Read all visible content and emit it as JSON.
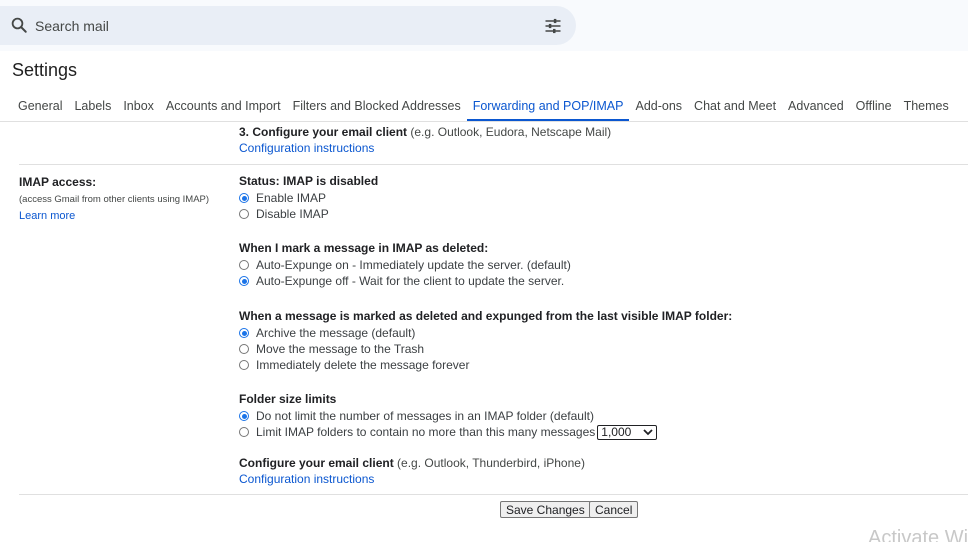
{
  "search": {
    "placeholder": "Search mail"
  },
  "page_title": "Settings",
  "tabs": [
    {
      "label": "General",
      "active": false
    },
    {
      "label": "Labels",
      "active": false
    },
    {
      "label": "Inbox",
      "active": false
    },
    {
      "label": "Accounts and Import",
      "active": false
    },
    {
      "label": "Filters and Blocked Addresses",
      "active": false
    },
    {
      "label": "Forwarding and POP/IMAP",
      "active": true
    },
    {
      "label": "Add-ons",
      "active": false
    },
    {
      "label": "Chat and Meet",
      "active": false
    },
    {
      "label": "Advanced",
      "active": false
    },
    {
      "label": "Offline",
      "active": false
    },
    {
      "label": "Themes",
      "active": false
    }
  ],
  "pop_config": {
    "heading": "3. Configure your email client",
    "hint": "(e.g. Outlook, Eudora, Netscape Mail)",
    "link": "Configuration instructions"
  },
  "imap": {
    "label": "IMAP access:",
    "sub": "(access Gmail from other clients using IMAP)",
    "learn_more": "Learn more",
    "status": "Status: IMAP is disabled",
    "access_options": [
      {
        "label": "Enable IMAP",
        "checked": true
      },
      {
        "label": "Disable IMAP",
        "checked": false
      }
    ],
    "deleted_heading": "When I mark a message in IMAP as deleted:",
    "deleted_options": [
      {
        "label": "Auto-Expunge on - Immediately update the server. (default)",
        "checked": false
      },
      {
        "label": "Auto-Expunge off - Wait for the client to update the server.",
        "checked": true
      }
    ],
    "expunged_heading": "When a message is marked as deleted and expunged from the last visible IMAP folder:",
    "expunged_options": [
      {
        "label": "Archive the message (default)",
        "checked": true
      },
      {
        "label": "Move the message to the Trash",
        "checked": false
      },
      {
        "label": "Immediately delete the message forever",
        "checked": false
      }
    ],
    "folder_heading": "Folder size limits",
    "folder_options": [
      {
        "label": "Do not limit the number of messages in an IMAP folder (default)",
        "checked": true
      },
      {
        "label": "Limit IMAP folders to contain no more than this many messages",
        "checked": false
      }
    ],
    "folder_limit_value": "1,000",
    "client_heading": "Configure your email client",
    "client_hint": "(e.g. Outlook, Thunderbird, iPhone)",
    "client_link": "Configuration instructions"
  },
  "buttons": {
    "save": "Save Changes",
    "cancel": "Cancel"
  },
  "watermark": "Activate Wi",
  "colors": {
    "accent": "#0b57d0",
    "search_bg": "#e9eef6"
  }
}
